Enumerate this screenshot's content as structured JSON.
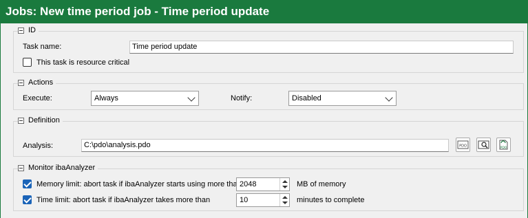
{
  "window": {
    "title": "Jobs: New time period job - Time period update"
  },
  "id_group": {
    "header": "ID",
    "task_name_label": "Task name:",
    "task_name_value": "Time period update",
    "resource_critical_label": "This task is resource critical"
  },
  "actions_group": {
    "header": "Actions",
    "execute_label": "Execute:",
    "execute_value": "Always",
    "notify_label": "Notify:",
    "notify_value": "Disabled"
  },
  "definition_group": {
    "header": "Definition",
    "analysis_label": "Analysis:",
    "analysis_value": "C:\\pdo\\analysis.pdo",
    "icons": [
      "pdo-browse-icon",
      "pdo-view-icon",
      "pdo-open-icon"
    ]
  },
  "monitor_group": {
    "header": "Monitor ibaAnalyzer",
    "memory_label": "Memory limit: abort task if ibaAnalyzer starts using more than",
    "memory_value": "2048",
    "memory_unit": "MB of memory",
    "time_label": "Time limit: abort task if ibaAnalyzer takes more than",
    "time_value": "10",
    "time_unit": "minutes to complete"
  },
  "colors": {
    "titlebar": "#1a7a3e",
    "checkbox_checked": "#1b64b8"
  }
}
